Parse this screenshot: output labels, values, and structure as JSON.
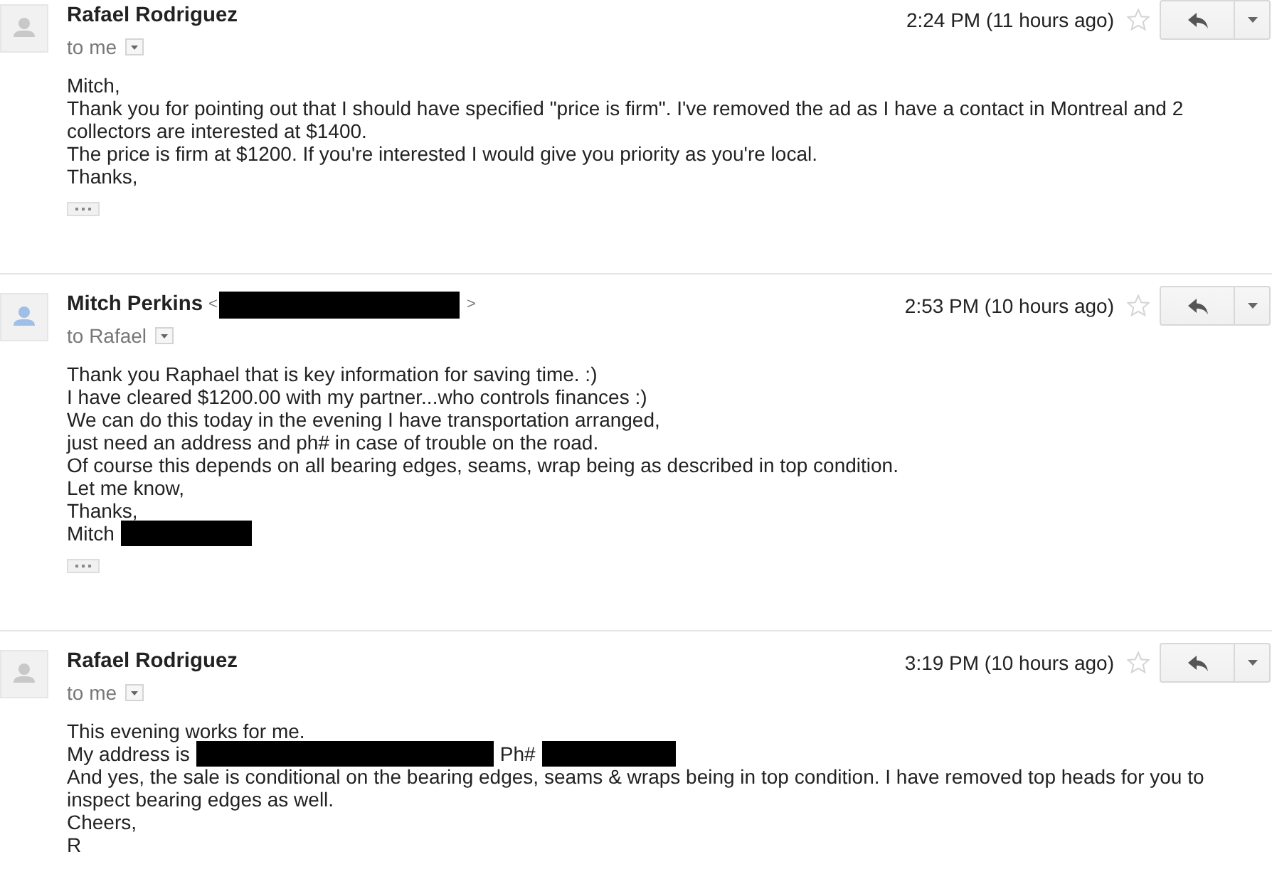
{
  "messages": [
    {
      "sender": "Rafael Rodriguez",
      "avatar": {
        "color": "#c8c8c8"
      },
      "recipient": "to me",
      "time": "2:24 PM (11 hours ago)",
      "starred": false,
      "body": [
        [
          {
            "kind": "text",
            "text": "Mitch,"
          }
        ],
        [
          {
            "kind": "text",
            "text": "Thank you for pointing out that I should have specified \"price is firm\". I've removed the ad as I have a contact in Montreal and 2"
          }
        ],
        [
          {
            "kind": "text",
            "text": "collectors are interested at $1400."
          }
        ],
        [
          {
            "kind": "text",
            "text": "The price is firm at $1200. If you're interested I would give you priority as you're local."
          }
        ],
        [
          {
            "kind": "text",
            "text": "Thanks,"
          }
        ]
      ],
      "show_trimmed": true
    },
    {
      "sender": "Mitch Perkins",
      "sender_extra": [
        {
          "kind": "text",
          "text": "<"
        },
        {
          "kind": "redacted"
        },
        {
          "kind": "text",
          "text": ">"
        }
      ],
      "avatar": {
        "color": "#9fbfe6"
      },
      "recipient": "to Rafael",
      "time": "2:53 PM (10 hours ago)",
      "starred": false,
      "body": [
        [
          {
            "kind": "text",
            "text": "Thank you Raphael that is key information for saving time. :)"
          }
        ],
        [
          {
            "kind": "text",
            "text": "I have cleared $1200.00 with my partner...who controls finances :)"
          }
        ],
        [
          {
            "kind": "text",
            "text": "We can do this today in the evening I have transportation arranged,"
          }
        ],
        [
          {
            "kind": "text",
            "text": "just need an address and ph# in case of trouble on the road."
          }
        ],
        [
          {
            "kind": "text",
            "text": "Of course this depends on all bearing edges, seams, wrap being as described in top condition."
          }
        ],
        [
          {
            "kind": "text",
            "text": "Let me know,"
          }
        ],
        [
          {
            "kind": "text",
            "text": "Thanks,"
          }
        ],
        [
          {
            "kind": "text",
            "text": "Mitch"
          },
          {
            "kind": "redacted"
          }
        ]
      ],
      "show_trimmed": true
    },
    {
      "sender": "Rafael Rodriguez",
      "avatar": {
        "color": "#c8c8c8"
      },
      "recipient": "to me",
      "time": "3:19 PM (10 hours ago)",
      "starred": false,
      "body": [
        [
          {
            "kind": "text",
            "text": "This evening works for me."
          }
        ],
        [
          {
            "kind": "text",
            "text": "My address is"
          },
          {
            "kind": "redacted"
          },
          {
            "kind": "text",
            "text": "Ph#"
          },
          {
            "kind": "redacted"
          }
        ],
        [
          {
            "kind": "text",
            "text": "And yes, the sale is conditional on the bearing edges, seams & wraps being in top condition. I have removed top heads for you to"
          }
        ],
        [
          {
            "kind": "text",
            "text": "inspect bearing edges as well."
          }
        ],
        [
          {
            "kind": "text",
            "text": "Cheers,"
          }
        ],
        [
          {
            "kind": "text",
            "text": "R"
          }
        ]
      ],
      "show_trimmed": false
    }
  ]
}
